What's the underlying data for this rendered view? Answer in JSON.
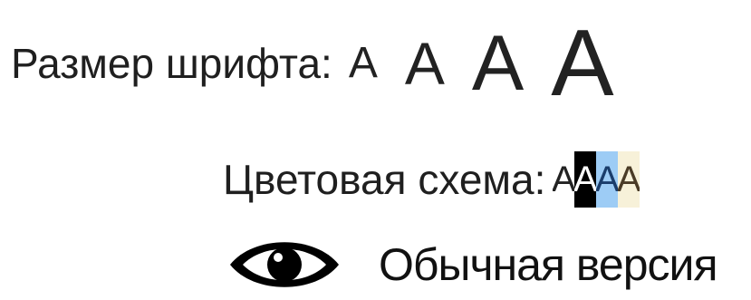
{
  "accessibility_panel": {
    "font_size": {
      "label": "Размер шрифта:",
      "options": [
        {
          "label": "A",
          "size": "small"
        },
        {
          "label": "A",
          "size": "medium"
        },
        {
          "label": "A",
          "size": "large"
        },
        {
          "label": "A",
          "size": "xlarge"
        }
      ]
    },
    "color_scheme": {
      "label": "Цветовая схема:",
      "options": [
        {
          "label": "A",
          "background": "#ffffff",
          "text": "#222222"
        },
        {
          "label": "A",
          "background": "#000000",
          "text": "#ffffff"
        },
        {
          "label": "A",
          "background": "#9dccf5",
          "text": "#1a3d6b"
        },
        {
          "label": "A",
          "background": "#f7f1d9",
          "text": "#4a3b26"
        }
      ]
    },
    "normal_version": {
      "icon": "eye-icon",
      "label": "Обычная версия"
    }
  }
}
